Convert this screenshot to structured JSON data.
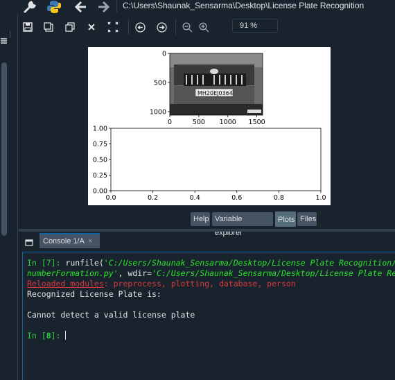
{
  "toolbar": {
    "icons": [
      "wrench-icon",
      "python-icon",
      "arrow-left-icon",
      "arrow-right-icon"
    ],
    "path": "C:\\Users\\Shaunak_Sensarma\\Desktop\\License Plate Recognition"
  },
  "plots_toolbar": {
    "icons": [
      "save-icon",
      "save-all-icon",
      "copy-icon",
      "close-icon",
      "close-all-icon",
      "previous-icon",
      "next-icon",
      "zoom-out-icon",
      "zoom-in-icon"
    ],
    "zoom": "91 %"
  },
  "chart_data": [
    {
      "type": "image",
      "image_ylabel_ticks": [
        "0",
        "500",
        "1000"
      ],
      "image_xlabel_ticks": [
        "0",
        "500",
        "1000",
        "1500"
      ],
      "plate_text": "MH20EJ0364"
    },
    {
      "type": "line",
      "title": "",
      "xlabel": "",
      "ylabel": "",
      "xlim": [
        0.0,
        1.0
      ],
      "ylim": [
        0.0,
        1.0
      ],
      "x_ticks": [
        "0.0",
        "0.2",
        "0.4",
        "0.6",
        "0.8",
        "1.0"
      ],
      "y_ticks": [
        "0.00",
        "0.25",
        "0.50",
        "0.75",
        "1.00"
      ],
      "series": []
    }
  ],
  "tabs": [
    "Help",
    "Variable explorer",
    "Plots",
    "Files"
  ],
  "active_tab": "Plots",
  "console": {
    "tab_label": "Console 1/A",
    "line1_prompt": "In [7]: ",
    "line1_cmd": "runfile(",
    "line1_arg": "'C:/Users/Shaunak_Sensarma/Desktop/License Plate Recognition/",
    "line2_arg": "numberFormation.py'",
    "line2_mid": ", wdir=",
    "line2_wdir": "'C:/Users/Shaunak_Sensarma/Desktop/License Plate Rec",
    "reloaded_label": "Reloaded modules",
    "reloaded_list": ": preprocess, plotting, database, person",
    "output1": "Recognized License Plate is:",
    "output2": "Cannot detect a valid license plate",
    "prompt2_a": "In [",
    "prompt2_num": "8",
    "prompt2_b": "]: "
  }
}
